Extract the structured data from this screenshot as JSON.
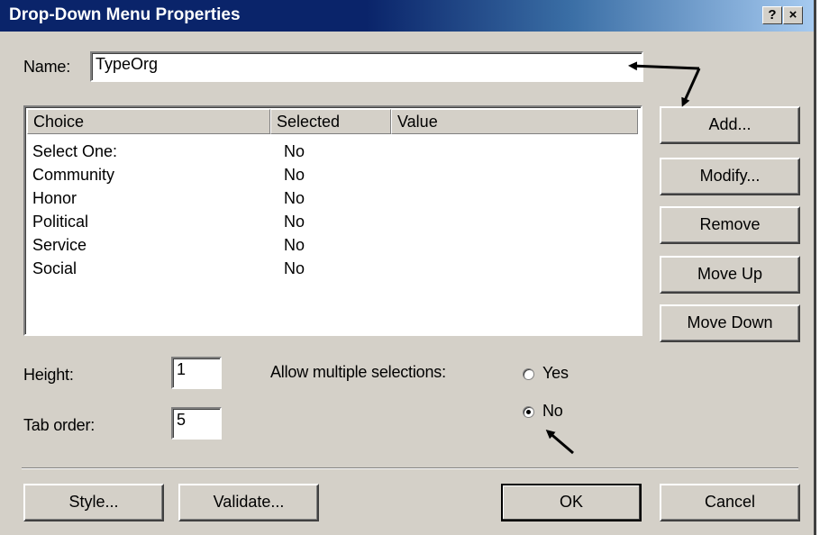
{
  "window": {
    "title": "Drop-Down Menu Properties",
    "help_button": "?",
    "close_button": "×"
  },
  "name_field": {
    "label": "Name:",
    "value": "TypeOrg"
  },
  "choices_list": {
    "columns": [
      "Choice",
      "Selected",
      "Value"
    ],
    "rows": [
      {
        "choice": "Select One:",
        "selected": "No",
        "value": ""
      },
      {
        "choice": "Community",
        "selected": "No",
        "value": ""
      },
      {
        "choice": "Honor",
        "selected": "No",
        "value": ""
      },
      {
        "choice": "Political",
        "selected": "No",
        "value": ""
      },
      {
        "choice": "Service",
        "selected": "No",
        "value": ""
      },
      {
        "choice": "Social",
        "selected": "No",
        "value": ""
      }
    ]
  },
  "side_buttons": {
    "add": "Add...",
    "modify": "Modify...",
    "remove": "Remove",
    "move_up": "Move Up",
    "move_down": "Move Down"
  },
  "height_field": {
    "label": "Height:",
    "value": "1"
  },
  "tab_order_field": {
    "label": "Tab order:",
    "value": "5"
  },
  "multiple_selections": {
    "label": "Allow multiple selections:",
    "options": [
      {
        "label": "Yes",
        "checked": false
      },
      {
        "label": "No",
        "checked": true
      }
    ]
  },
  "bottom_buttons": {
    "style": "Style...",
    "validate": "Validate...",
    "ok": "OK",
    "cancel": "Cancel"
  },
  "colors": {
    "titlebar_start": "#0a246a",
    "titlebar_end": "#a6caf0",
    "dialog_face": "#d4d0c8"
  }
}
